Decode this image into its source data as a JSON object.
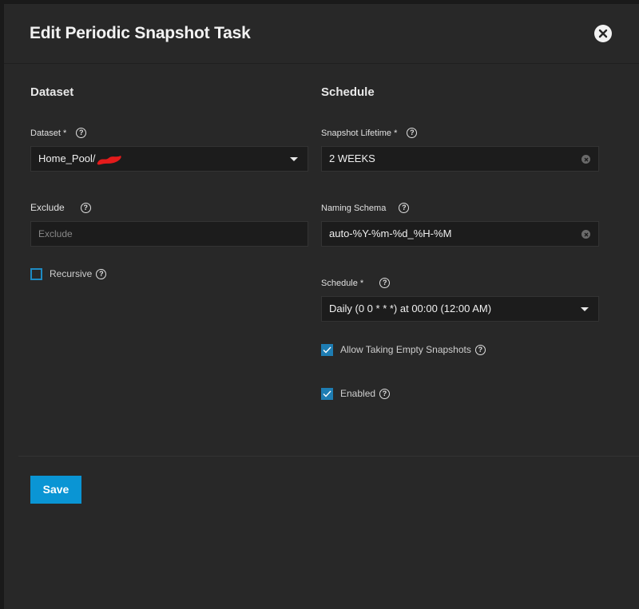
{
  "dialog": {
    "title": "Edit Periodic Snapshot Task"
  },
  "dataset_section": {
    "heading": "Dataset",
    "dataset": {
      "label": "Dataset *",
      "value": "Home_Pool/"
    },
    "exclude": {
      "label": "Exclude",
      "placeholder": "Exclude"
    },
    "recursive": {
      "label": "Recursive",
      "checked": false
    }
  },
  "schedule_section": {
    "heading": "Schedule",
    "snapshot_lifetime": {
      "label": "Snapshot Lifetime *",
      "value": "2 WEEKS"
    },
    "naming_schema": {
      "label": "Naming Schema",
      "value": "auto-%Y-%m-%d_%H-%M"
    },
    "schedule": {
      "label": "Schedule *",
      "value": "Daily (0 0 * * *) at 00:00 (12:00 AM)"
    },
    "allow_empty": {
      "label": "Allow Taking Empty Snapshots",
      "checked": true
    },
    "enabled": {
      "label": "Enabled",
      "checked": true
    }
  },
  "actions": {
    "save_label": "Save"
  },
  "icons": {
    "help": "?"
  },
  "colors": {
    "accent": "#0a95d4",
    "checkbox": "#1e7db3",
    "redaction": "#e41b1b"
  }
}
